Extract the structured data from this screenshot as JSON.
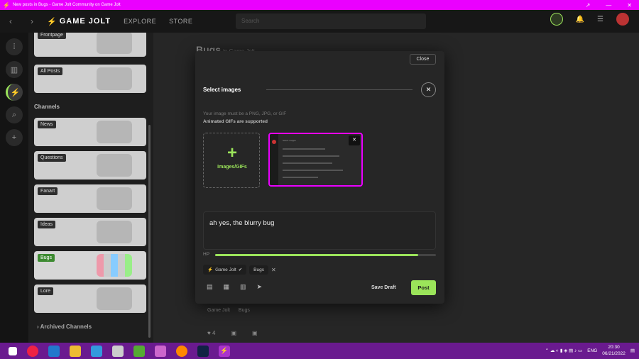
{
  "window": {
    "title": "New posts in Bugs - Game Jolt Community on Game Jolt",
    "controls": [
      "↗",
      "—",
      "✕"
    ]
  },
  "topnav": {
    "brand": "GAME JOLT",
    "explore": "EXPLORE",
    "store": "STORE",
    "search_placeholder": "Search"
  },
  "channels": {
    "heading": "Channels",
    "top_items": [
      "Frontpage",
      "All Posts"
    ],
    "items": [
      "News",
      "Questions",
      "Fanart",
      "Ideas",
      "Bugs",
      "Lore"
    ],
    "archived": "Archived Channels"
  },
  "background": {
    "heading": "Bugs",
    "heading_sub": "in Game Jolt",
    "post_community": "Game Jolt",
    "post_channel": "Bugs",
    "like_count": "4"
  },
  "modal": {
    "close_label": "Close",
    "title": "Select images",
    "hint_formats": "Your image must be a PNG, JPG, or GIF",
    "hint_gifs": "Animated GIFs are supported",
    "add_label": "Images/GIFs",
    "thumb_title": "Select images",
    "body_text": "ah yes, the blurry bug",
    "hp_label": "HP",
    "hp_progress": 0.92,
    "tag_community": "Game Jolt",
    "tag_channel": "Bugs",
    "save_draft": "Save Draft",
    "post_label": "Post"
  },
  "taskbar": {
    "lang": "ENG",
    "time": "20:30",
    "date": "06/21/2022"
  },
  "colors": {
    "accent": "#9be45a",
    "magenta": "#ea00ff",
    "taskbar": "#6a1a8f"
  }
}
